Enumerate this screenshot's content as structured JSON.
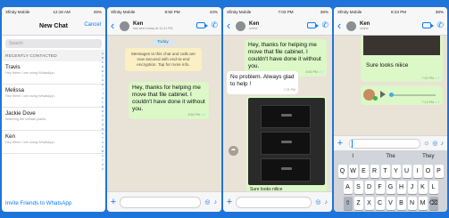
{
  "phone1": {
    "status": {
      "left": "Xfinity Mobile",
      "time": "12:18 AM",
      "battery": "25%"
    },
    "title": "New Chat",
    "cancel_label": "Cancel",
    "search_placeholder": "Search",
    "section_header": "RECENTLY CONTACTED",
    "contacts": [
      {
        "name": "Travis",
        "status": "Hey there! I am using WhatsApp."
      },
      {
        "name": "Melissa",
        "status": "Hey there! I am using WhatsApp."
      },
      {
        "name": "Jackie Dove",
        "status": "Watering the tomato plants"
      },
      {
        "name": "Ken",
        "status": "Hey there! I am using WhatsApp."
      }
    ],
    "invite_label": "Invite Friends to WhatsApp"
  },
  "phone2": {
    "status": {
      "left": "Xfinity Mobile",
      "time": "8:50 PM",
      "battery": "43%"
    },
    "contact_name": "Ken",
    "contact_sub": "last seen today at 12:41 PM",
    "day_chip": "Today",
    "system_message": "Messages to this chat and calls are now secured with end-to-end encryption. Tap for more info.",
    "message": {
      "text": "Hey, thanks for helping me move that file cabinet. I couldn't have done it without you.",
      "time": "8:50 PM"
    }
  },
  "phone3": {
    "status": {
      "left": "Xfinity Mobile",
      "time": "7:03 PM",
      "battery": "38%"
    },
    "contact_name": "Ken",
    "contact_sub": "online",
    "message_out": {
      "text": "Hey, thanks for helping me move that file cabinet. I couldn't have done it without you.",
      "time": "8:50 PM"
    },
    "message_in": {
      "text": "No problem. Always glad to help !",
      "time": "7:01 PM"
    },
    "image_caption": "Sure looks nilice"
  },
  "phone4": {
    "status": {
      "left": "Xfinity Mobile",
      "time": "8:23 PM",
      "battery": "38%"
    },
    "contact_name": "Ken",
    "contact_sub": "online",
    "image_caption": "Sure looks niiice",
    "image_time": "7:02 PM",
    "voice_time": "7:13 PM",
    "suggestions": [
      "I",
      "The",
      "They"
    ],
    "keyboard": {
      "row1": [
        "Q",
        "W",
        "E",
        "R",
        "T",
        "Y",
        "U",
        "I",
        "O",
        "P"
      ],
      "row2": [
        "A",
        "S",
        "D",
        "F",
        "G",
        "H",
        "J",
        "K",
        "L"
      ],
      "row3": [
        "Z",
        "X",
        "C",
        "V",
        "B",
        "N",
        "M"
      ],
      "numbers_key": "123",
      "space_key": "space"
    }
  }
}
